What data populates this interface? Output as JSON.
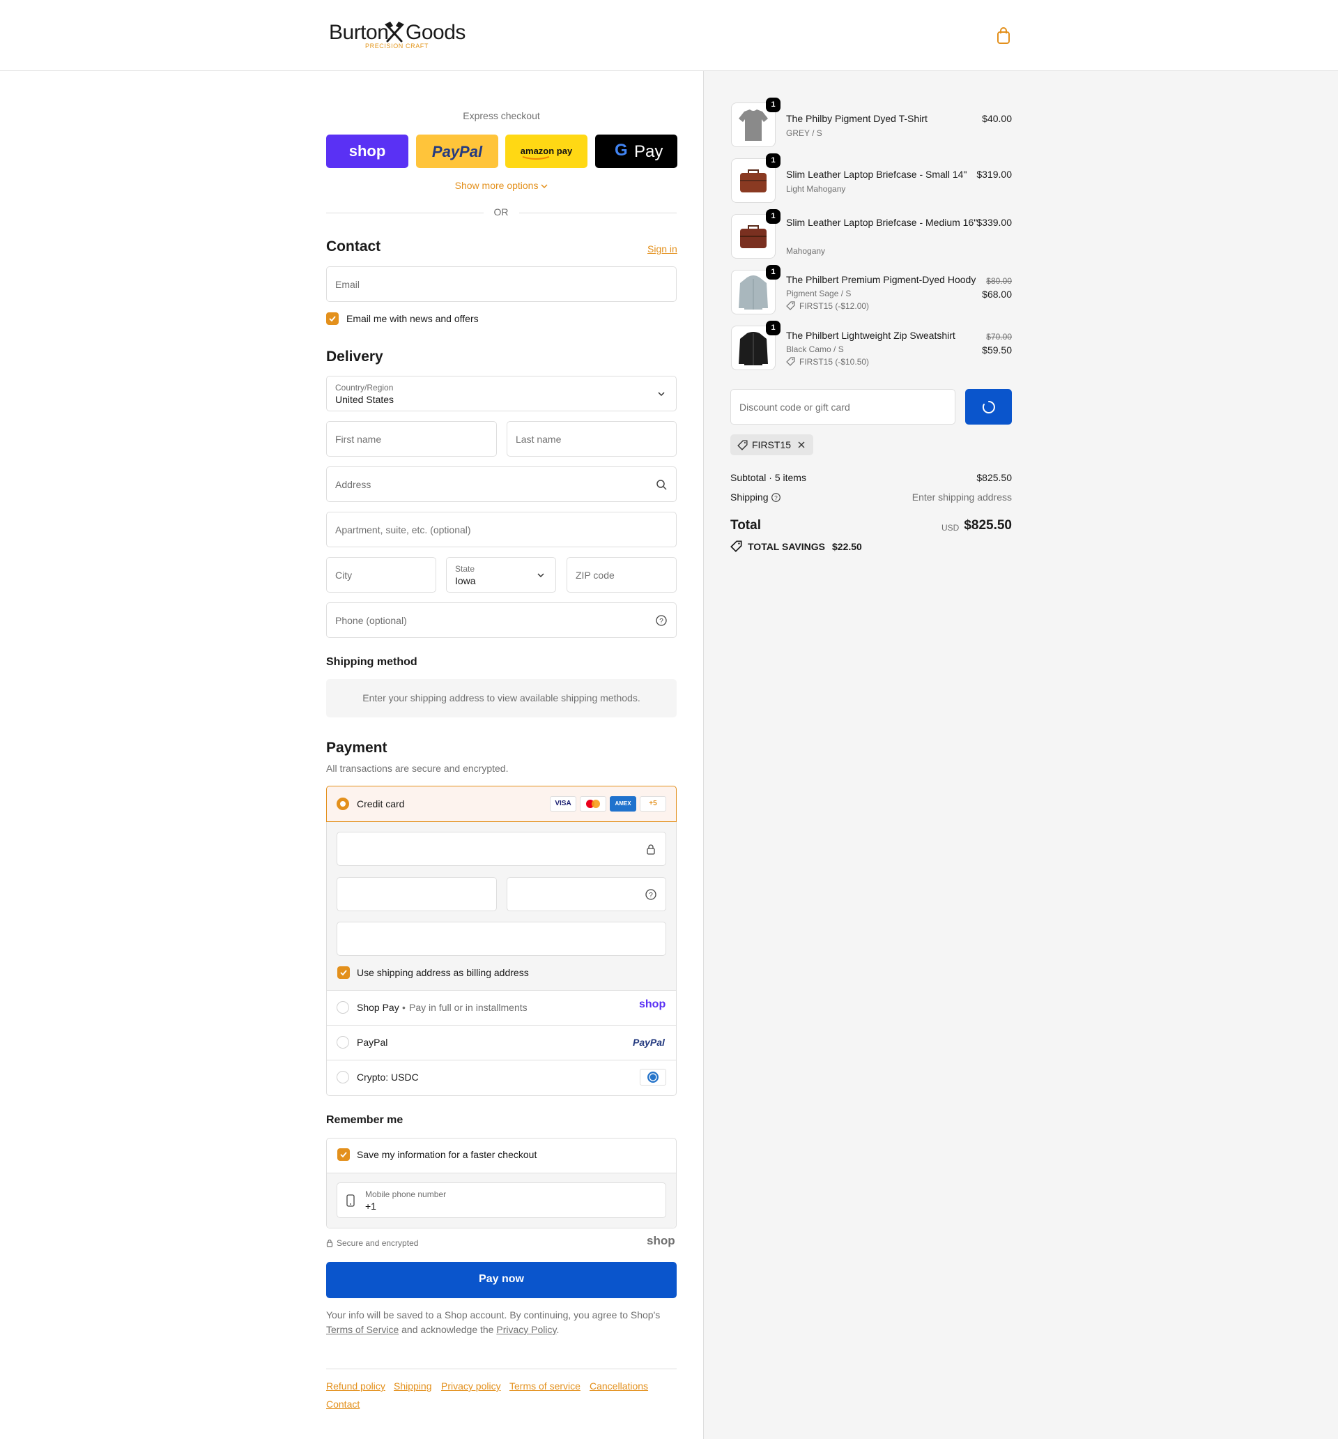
{
  "brand": {
    "name_left": "Burton",
    "name_right": "Goods",
    "tagline": "PRECISION CRAFT",
    "accent_color": "#e3901c",
    "primary_button_color": "#0a55cc"
  },
  "header": {
    "cart_icon": "shopping-bag-icon"
  },
  "express": {
    "title": "Express checkout",
    "buttons": [
      {
        "name": "shop",
        "label": "shop",
        "color": "#5a31f4"
      },
      {
        "name": "paypal",
        "label": "PayPal",
        "color": "#ffc43a"
      },
      {
        "name": "amazon-pay",
        "label": "amazon pay",
        "color": "#ffd814"
      },
      {
        "name": "google-pay",
        "label": "Pay",
        "color": "#000000"
      }
    ],
    "more_options": "Show more options",
    "or": "OR"
  },
  "contact": {
    "heading": "Contact",
    "sign_in": "Sign in",
    "email_placeholder": "Email",
    "newsletter_label": "Email me with news and offers"
  },
  "delivery": {
    "heading": "Delivery",
    "country_label": "Country/Region",
    "country_value": "United States",
    "first_name": "First name",
    "last_name": "Last name",
    "address": "Address",
    "apartment": "Apartment, suite, etc. (optional)",
    "city": "City",
    "state_label": "State",
    "state_value": "Iowa",
    "zip": "ZIP code",
    "phone": "Phone (optional)"
  },
  "shipping_method": {
    "heading": "Shipping method",
    "note": "Enter your shipping address to view available shipping methods."
  },
  "payment": {
    "heading": "Payment",
    "subtitle": "All transactions are secure and encrypted.",
    "credit_card": "Credit card",
    "card_badges": [
      "VISA",
      "",
      "AMEX",
      "+5"
    ],
    "billing_label": "Use shipping address as billing address",
    "shop_pay": "Shop Pay",
    "shop_pay_note": "Pay in full or in installments",
    "shop_pay_logo": "shop",
    "paypal": "PayPal",
    "paypal_logo": "PayPal",
    "crypto": "Crypto: USDC"
  },
  "remember": {
    "heading": "Remember me",
    "save_label": "Save my information for a faster checkout",
    "mobile_label": "Mobile phone number",
    "mobile_value": "+1",
    "secure": "Secure and encrypted",
    "shop_logo": "shop"
  },
  "pay_now": "Pay now",
  "legal": {
    "text1": "Your info will be saved to a Shop account. By continuing, you agree to Shop's",
    "terms": "Terms of Service",
    "text2": "and acknowledge the",
    "privacy": "Privacy Policy",
    "period": "."
  },
  "footer_links": [
    "Refund policy",
    "Shipping",
    "Privacy policy",
    "Terms of service",
    "Cancellations",
    "Contact"
  ],
  "order": {
    "items": [
      {
        "name": "The Philby Pigment Dyed T-Shirt",
        "variant": "GREY / S",
        "price": "$40.00",
        "qty": "1"
      },
      {
        "name": "Slim Leather Laptop Briefcase - Small 14\"",
        "variant": "Light Mahogany",
        "price": "$319.00",
        "qty": "1"
      },
      {
        "name": "Slim Leather Laptop Briefcase - Medium 16\"",
        "variant": "Mahogany",
        "price": "$339.00",
        "qty": "1"
      },
      {
        "name": "The Philbert Premium Pigment-Dyed Hoody",
        "variant": "Pigment Sage / S",
        "discount": "FIRST15 (-$12.00)",
        "original": "$80.00",
        "price": "$68.00",
        "qty": "1"
      },
      {
        "name": "The Philbert Lightweight Zip Sweatshirt",
        "variant": "Black Camo / S",
        "discount": "FIRST15 (-$10.50)",
        "original": "$70.00",
        "price": "$59.50",
        "qty": "1"
      }
    ],
    "discount_placeholder": "Discount code or gift card",
    "applied_code": "FIRST15",
    "subtotal_label": "Subtotal · 5 items",
    "subtotal_value": "$825.50",
    "shipping_label": "Shipping",
    "shipping_value": "Enter shipping address",
    "total_label": "Total",
    "currency": "USD",
    "total_value": "$825.50",
    "savings_label": "TOTAL SAVINGS",
    "savings_value": "$22.50"
  }
}
